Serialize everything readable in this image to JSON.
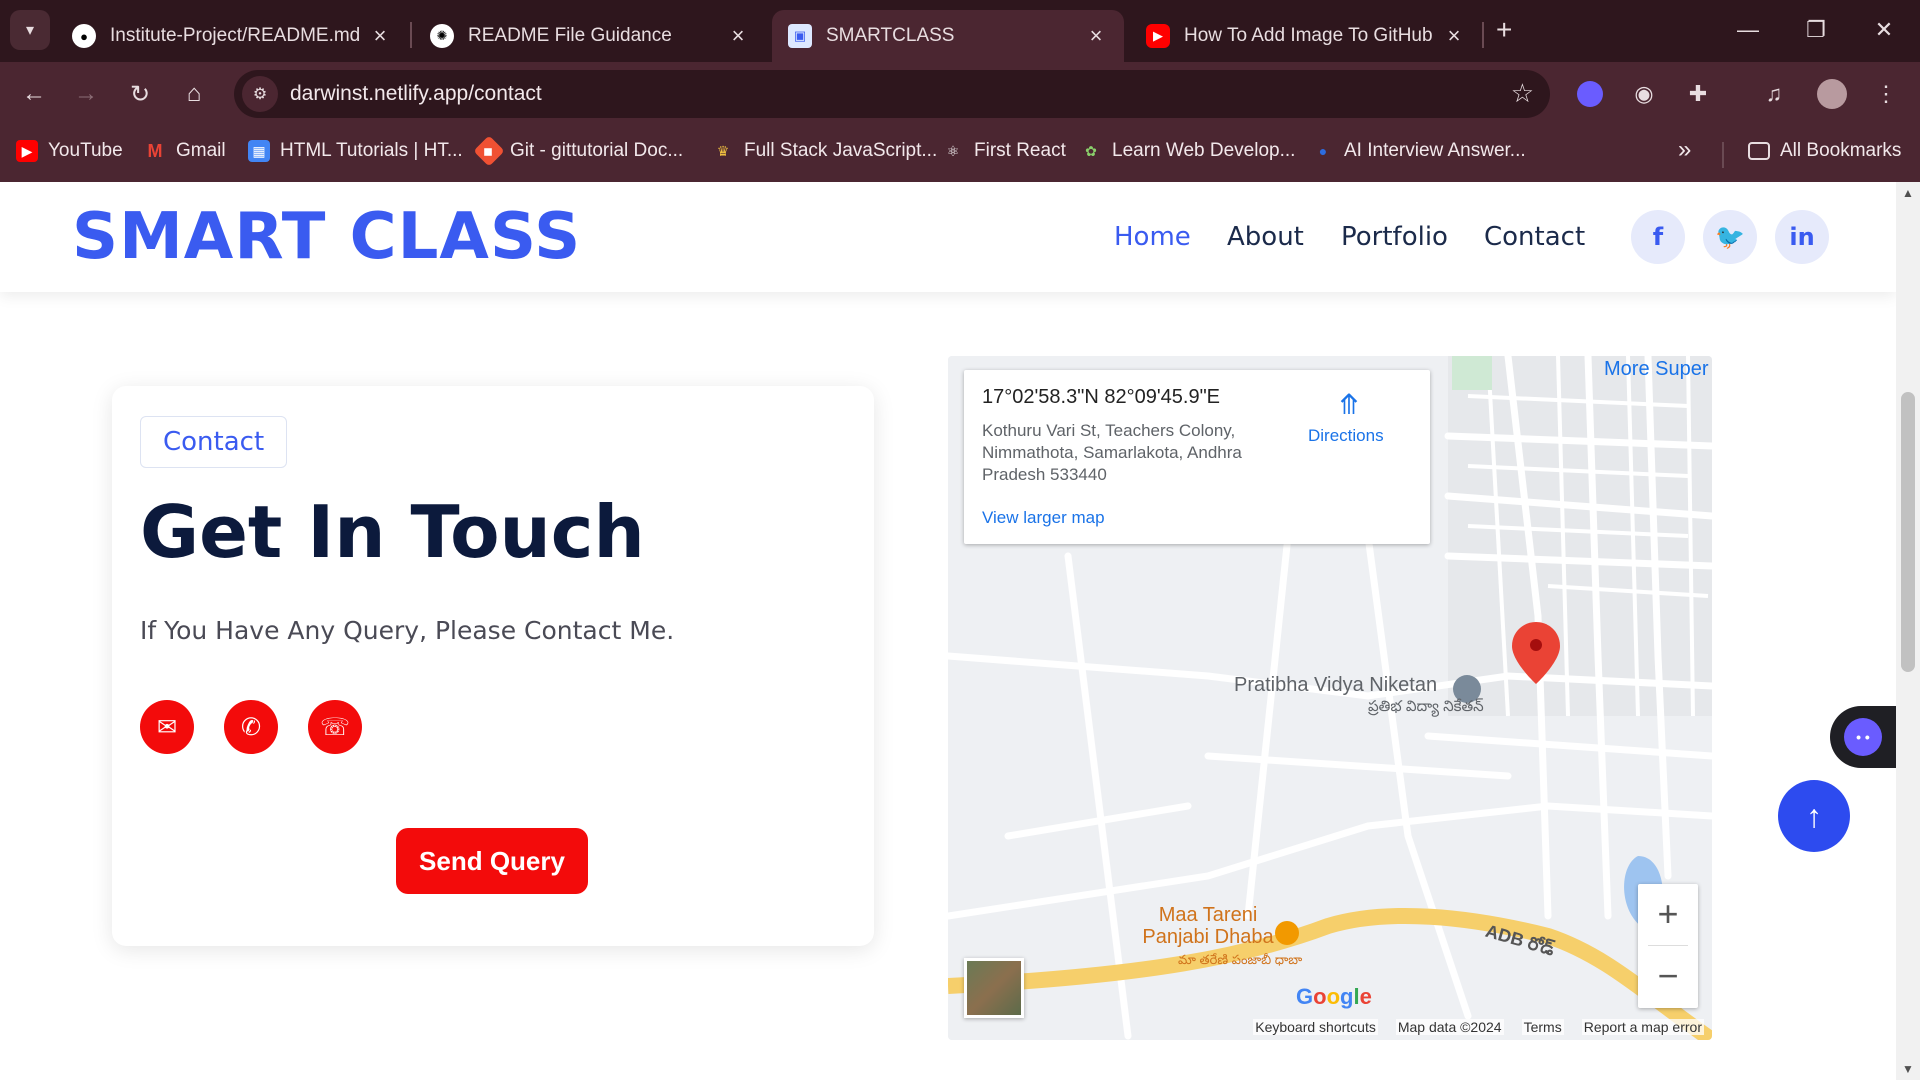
{
  "browser": {
    "tabs": [
      {
        "title": "Institute-Project/README.md at",
        "icon": "github-icon"
      },
      {
        "title": "README File Guidance",
        "icon": "chatgpt-icon"
      },
      {
        "title": "SMARTCLASS",
        "icon": "smartclass-icon"
      },
      {
        "title": "How To Add Image To GitHub R",
        "icon": "youtube-icon"
      }
    ],
    "url": "darwinst.netlify.app/contact",
    "bookmarks": [
      {
        "label": "YouTube",
        "color": "#ff0000"
      },
      {
        "label": "Gmail",
        "color": "#ea4335"
      },
      {
        "label": "HTML Tutorials | HT...",
        "color": "#4285f4"
      },
      {
        "label": "Git - gittutorial Doc...",
        "color": "#f05133"
      },
      {
        "label": "Full Stack JavaScript...",
        "color": "#f0c040"
      },
      {
        "label": "First React",
        "color": "#ffffff"
      },
      {
        "label": "Learn Web Develop...",
        "color": "#8ad06b"
      },
      {
        "label": "AI Interview Answer...",
        "color": "#2d6cdf"
      }
    ],
    "all_bookmarks": "All Bookmarks",
    "overflow": "»"
  },
  "site": {
    "logo": "SMART CLASS",
    "menu": [
      "Home",
      "About",
      "Portfolio",
      "Contact"
    ],
    "social": [
      {
        "label": "f",
        "icon": "facebook-icon"
      },
      {
        "label": "t",
        "icon": "twitter-icon"
      },
      {
        "label": "in",
        "icon": "linkedin-icon"
      }
    ]
  },
  "contact": {
    "tag": "Contact",
    "heading": "Get In Touch",
    "subtext": "If You Have Any Query, Please Contact Me.",
    "button": "Send Query"
  },
  "map": {
    "coords": "17°02'58.3\"N 82°09'45.9\"E",
    "address": "Kothuru Vari St, Teachers Colony, Nimmathota, Samarlakota, Andhra Pradesh 533440",
    "directions": "Directions",
    "larger_map": "View larger map",
    "labels": {
      "school": "Pratibha Vidya Niketan",
      "school_telugu": "ప్రతిభ విద్యా నికేతన్",
      "dhaba": "Maa Tareni Panjabi Dhaba",
      "dhaba_telugu": "మా తరేణి పంజాబీ ధాబా",
      "road": "ADB రోడ్",
      "top_right": "More Super - Sam"
    },
    "google": "Google",
    "footer": [
      "Keyboard shortcuts",
      "Map data ©2024",
      "Terms",
      "Report a map error"
    ]
  }
}
